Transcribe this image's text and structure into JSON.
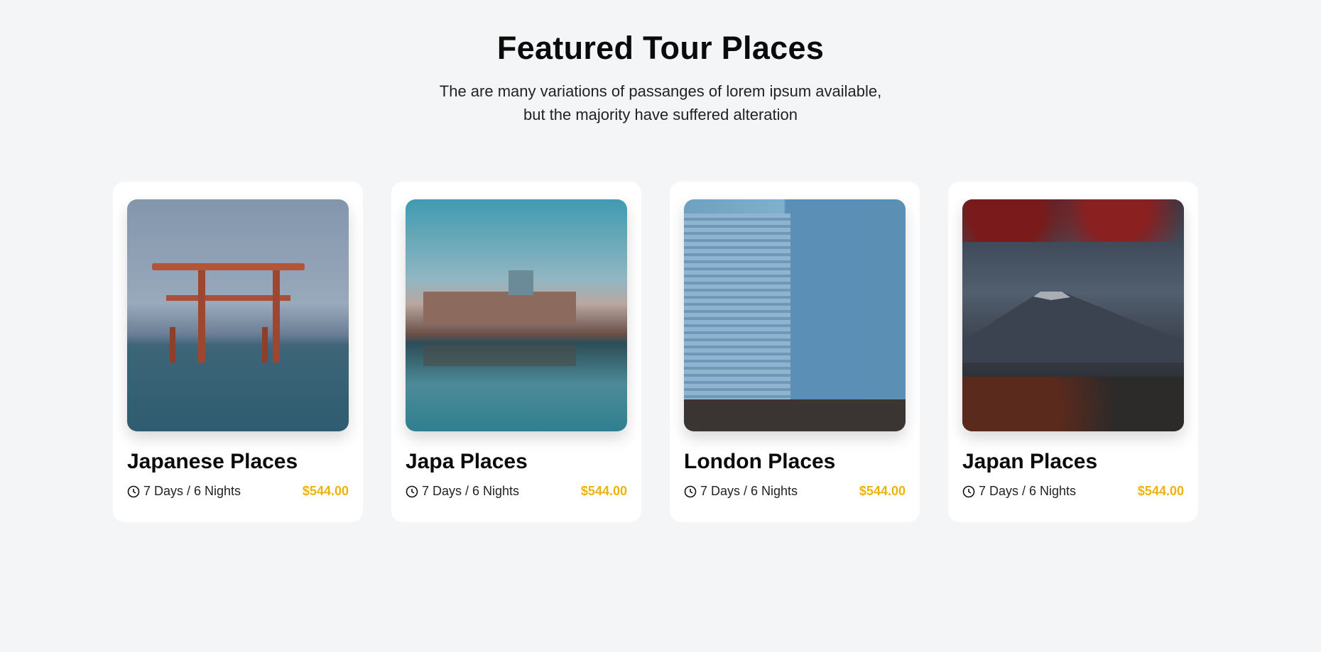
{
  "header": {
    "title": "Featured Tour Places",
    "subtitle_line1": "The are many variations of passanges of lorem ipsum available,",
    "subtitle_line2": "but the majority have suffered alteration"
  },
  "colors": {
    "price": "#ebb30c",
    "background": "#f4f5f7"
  },
  "cards": [
    {
      "title": "Japanese Places",
      "duration": "7 Days / 6 Nights",
      "price": "$544.00",
      "icon": "clock-icon"
    },
    {
      "title": "Japa Places",
      "duration": "7 Days / 6 Nights",
      "price": "$544.00",
      "icon": "clock-icon"
    },
    {
      "title": "London Places",
      "duration": "7 Days / 6 Nights",
      "price": "$544.00",
      "icon": "clock-icon"
    },
    {
      "title": "Japan Places",
      "duration": "7 Days / 6 Nights",
      "price": "$544.00",
      "icon": "clock-icon"
    }
  ]
}
